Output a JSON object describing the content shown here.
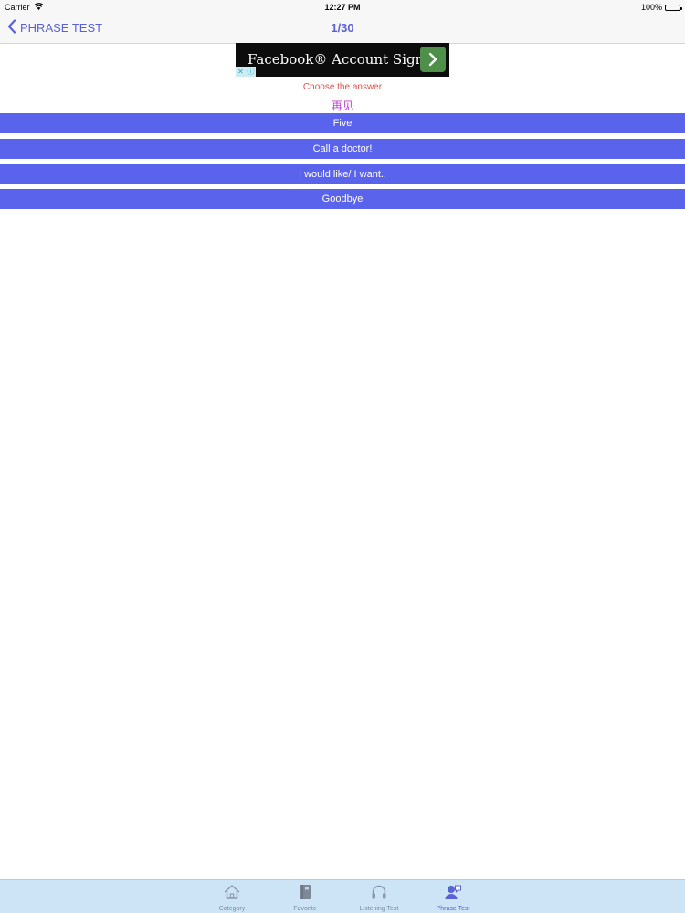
{
  "status_bar": {
    "carrier": "Carrier",
    "time": "12:27 PM",
    "battery": "100%",
    "battery_level": 1.0
  },
  "nav": {
    "back_label": "PHRASE TEST",
    "title": "1/30"
  },
  "ad": {
    "text": "Facebook® Account Sign U",
    "arrow_icon": "chevron-right-icon",
    "close_glyph": "✕",
    "info_glyph": "ⓘ"
  },
  "quiz": {
    "prompt": "Choose the answer",
    "question": "再见",
    "answers": [
      "Five",
      "Call a doctor!",
      "I would like/ I want..",
      "Goodbye"
    ]
  },
  "tab_bar": {
    "active_index": 3,
    "tabs": [
      {
        "label": "Category",
        "icon": "home-icon"
      },
      {
        "label": "Favorite",
        "icon": "book-icon"
      },
      {
        "label": "Listening Test",
        "icon": "headphones-icon"
      },
      {
        "label": "Phrase Test",
        "icon": "person-chat-icon"
      }
    ]
  },
  "colors": {
    "accent": "#5a63d6",
    "answer_bg": "#5a63ec",
    "prompt": "#e0524a",
    "question": "#c041d6",
    "tab_bar_bg": "#cde3f6"
  }
}
